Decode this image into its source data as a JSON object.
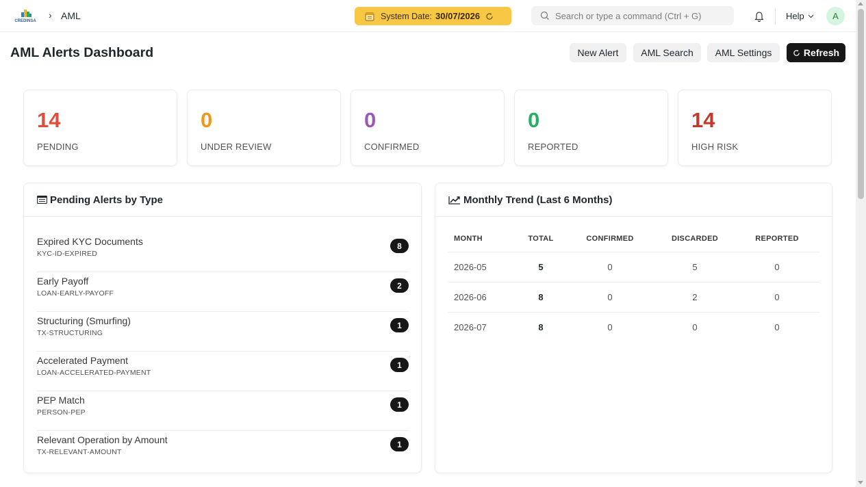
{
  "navbar": {
    "logo_text": "CREDINSA",
    "breadcrumb_sep": "›",
    "breadcrumb": "AML",
    "system_date_label": "System Date:",
    "system_date_value": "30/07/2026",
    "search_placeholder": "Search or type a command (Ctrl + G)",
    "help_label": "Help",
    "avatar_initial": "A"
  },
  "page": {
    "title": "AML Alerts Dashboard",
    "buttons": {
      "new_alert": "New Alert",
      "aml_search": "AML Search",
      "aml_settings": "AML Settings",
      "refresh": "Refresh"
    }
  },
  "stats": [
    {
      "value": "14",
      "label": "PENDING",
      "color": "#e24c3b"
    },
    {
      "value": "0",
      "label": "UNDER REVIEW",
      "color": "#f0961a"
    },
    {
      "value": "0",
      "label": "CONFIRMED",
      "color": "#9b59b6"
    },
    {
      "value": "0",
      "label": "REPORTED",
      "color": "#27ae60"
    },
    {
      "value": "14",
      "label": "HIGH RISK",
      "color": "#c0392b"
    }
  ],
  "pending_by_type": {
    "title": "Pending Alerts by Type",
    "items": [
      {
        "name": "Expired KYC Documents",
        "code": "KYC-ID-EXPIRED",
        "count": "8"
      },
      {
        "name": "Early Payoff",
        "code": "LOAN-EARLY-PAYOFF",
        "count": "2"
      },
      {
        "name": "Structuring (Smurfing)",
        "code": "TX-STRUCTURING",
        "count": "1"
      },
      {
        "name": "Accelerated Payment",
        "code": "LOAN-ACCELERATED-PAYMENT",
        "count": "1"
      },
      {
        "name": "PEP Match",
        "code": "PERSON-PEP",
        "count": "1"
      },
      {
        "name": "Relevant Operation by Amount",
        "code": "TX-RELEVANT-AMOUNT",
        "count": "1"
      }
    ]
  },
  "monthly_trend": {
    "title": "Monthly Trend (Last 6 Months)",
    "columns": [
      "MONTH",
      "TOTAL",
      "CONFIRMED",
      "DISCARDED",
      "REPORTED"
    ],
    "rows": [
      {
        "month": "2026-05",
        "total": "5",
        "confirmed": "0",
        "discarded": "5",
        "reported": "0"
      },
      {
        "month": "2026-06",
        "total": "8",
        "confirmed": "0",
        "discarded": "2",
        "reported": "0"
      },
      {
        "month": "2026-07",
        "total": "8",
        "confirmed": "0",
        "discarded": "0",
        "reported": "0"
      }
    ]
  },
  "icons": {
    "calendar": "calendar-icon",
    "refresh": "refresh-icon",
    "search": "search-icon",
    "bell": "bell-icon",
    "chevron": "chevron-down-icon",
    "list": "list-icon",
    "trend": "trend-chart-icon"
  }
}
